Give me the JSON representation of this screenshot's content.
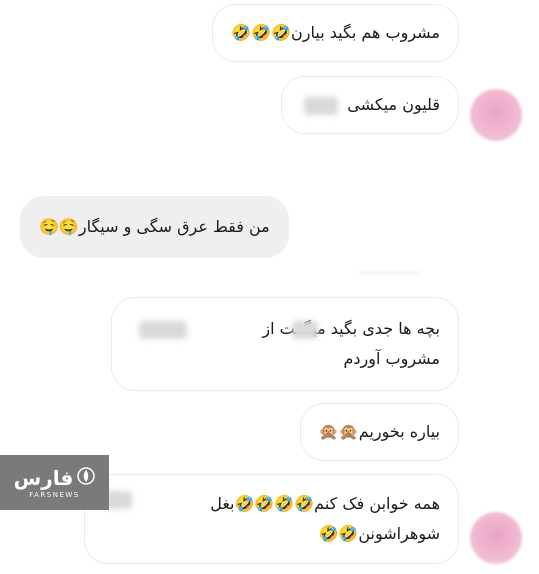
{
  "messages": [
    {
      "id": "m1",
      "lines": [
        "مشروب هم بگید بیارن🤣🤣🤣"
      ]
    },
    {
      "id": "m2",
      "lines": [
        "قلیون میکشی"
      ]
    },
    {
      "id": "m3",
      "lines": [
        "من فقط عرق سگی و سیگار🤤🤤"
      ]
    },
    {
      "id": "m4",
      "lines": [
        "بچه ها جدی بگید  میگفت از",
        "مشروب آوردم"
      ]
    },
    {
      "id": "m5",
      "lines": [
        "بیاره بخوریم🙊🙊"
      ]
    },
    {
      "id": "m6",
      "lines": [
        "همه خوابن فک کنم🤣🤣🤣🤣بغل",
        "شوهراشونن🤣🤣"
      ]
    }
  ],
  "watermark": {
    "logo_text": "فارس",
    "sub_text": "FARSNEWS",
    "icon": "farsnews-emblem-icon"
  },
  "colors": {
    "incoming_bubble_bg": "#ffffff",
    "outgoing_bubble_bg": "#efefef",
    "watermark_bg": "#7a7a7a"
  }
}
